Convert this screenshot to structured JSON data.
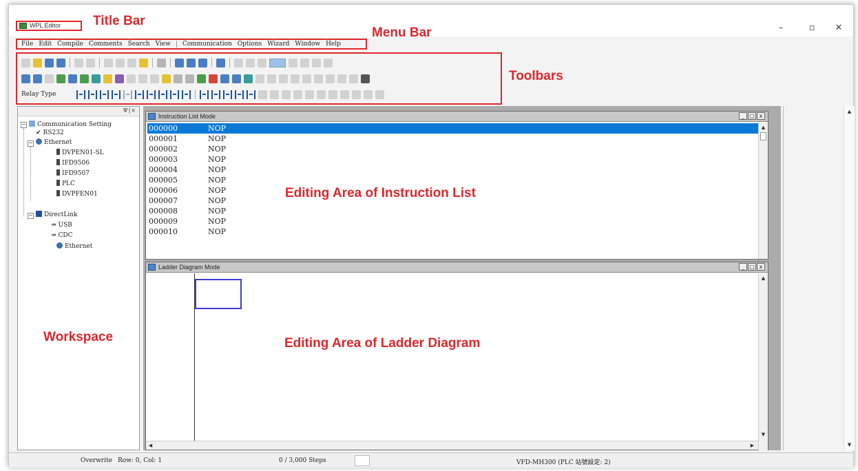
{
  "window": {
    "title": "WPL Editor",
    "controls": {
      "minimize": "–",
      "restore": "▫",
      "close": "✕"
    }
  },
  "menu": [
    "File",
    "Edit",
    "Compile",
    "Comments",
    "Search",
    "View",
    "Communication",
    "Options",
    "Wizard",
    "Window",
    "Help"
  ],
  "toolbar": {
    "relay_type_label": "Relay Type",
    "accent": "#e0262b"
  },
  "workspace": {
    "minimize_btn": "Ψ|×",
    "tree": {
      "root": "Communication Setting",
      "rs232": "RS232",
      "ethernet": "Ethernet",
      "ethernet_children": [
        "DVPEN01-SL",
        "IFD9506",
        "IFD9507",
        "PLC",
        "DVPFEN01"
      ],
      "directlink": "DirectLink",
      "directlink_children": [
        "USB",
        "CDC",
        "Ethernet"
      ]
    }
  },
  "instruction_window": {
    "title": "Instruction List Mode",
    "rows": [
      {
        "addr": "000000",
        "op": "NOP"
      },
      {
        "addr": "000001",
        "op": "NOP"
      },
      {
        "addr": "000002",
        "op": "NOP"
      },
      {
        "addr": "000003",
        "op": "NOP"
      },
      {
        "addr": "000004",
        "op": "NOP"
      },
      {
        "addr": "000005",
        "op": "NOP"
      },
      {
        "addr": "000006",
        "op": "NOP"
      },
      {
        "addr": "000007",
        "op": "NOP"
      },
      {
        "addr": "000008",
        "op": "NOP"
      },
      {
        "addr": "000009",
        "op": "NOP"
      },
      {
        "addr": "000010",
        "op": "NOP"
      }
    ],
    "selected_row": 0
  },
  "ladder_window": {
    "title": "Ladder Diagram Mode"
  },
  "child_buttons": {
    "min": "_",
    "max": "□",
    "close": "x"
  },
  "status": {
    "mode": "Overwrite",
    "position": "Row: 0, Col: 1",
    "steps": "0 / 3,000 Steps",
    "device": "VFD-MH300 (PLC 站號設定: 2)"
  },
  "callouts": {
    "title_bar": "Title Bar",
    "menu_bar": "Menu Bar",
    "toolbars": "Toolbars",
    "workspace": "Workspace",
    "instruction_area": "Editing Area of Instruction List",
    "ladder_area": "Editing Area of Ladder Diagram"
  }
}
